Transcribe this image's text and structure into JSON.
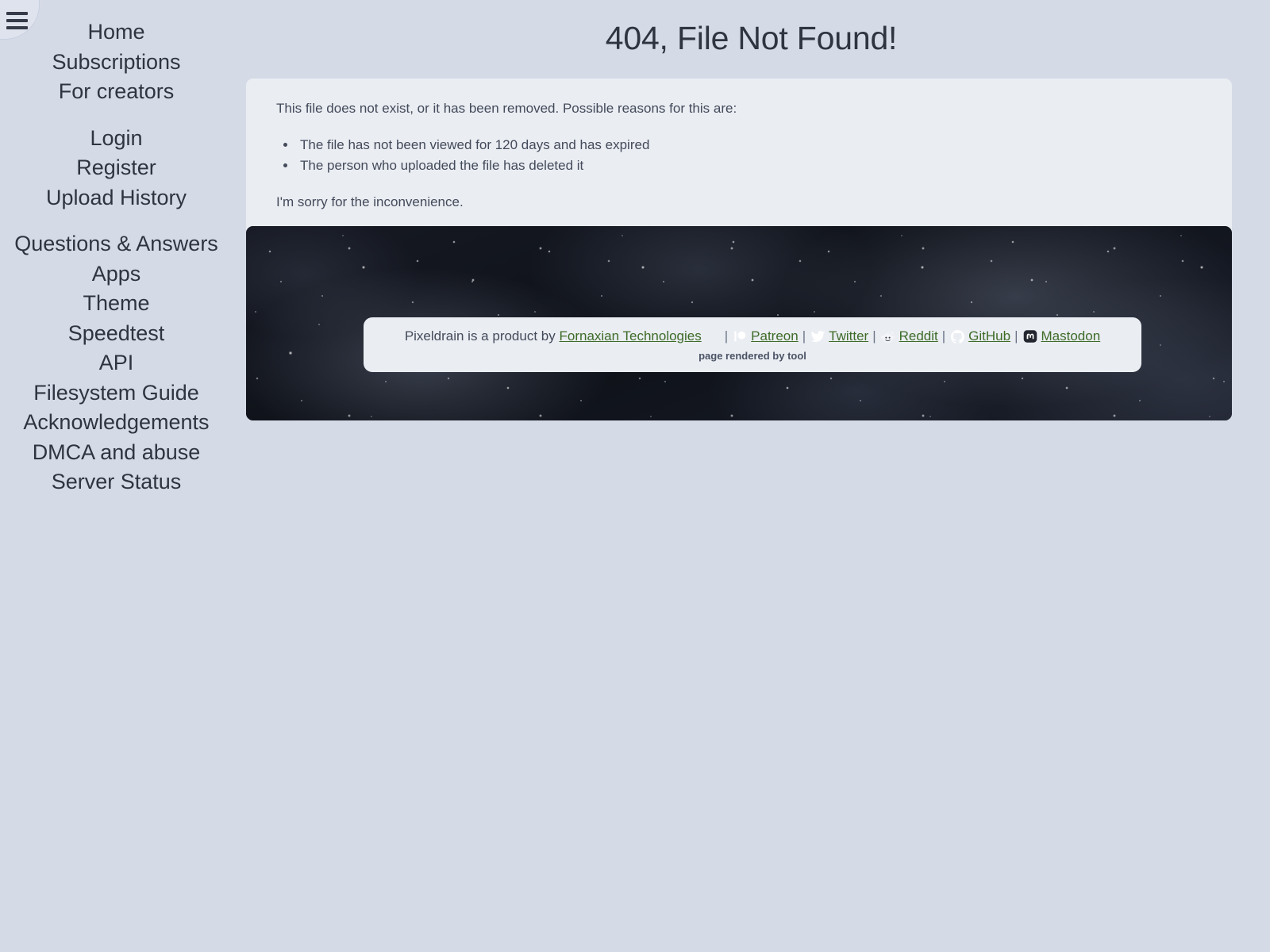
{
  "app": {
    "name": "Pixeldrain",
    "menu_toggle_label": "Toggle navigation menu"
  },
  "sidebar": {
    "groups": [
      {
        "items": [
          {
            "label": "Home",
            "icon": "home-icon"
          },
          {
            "label": "Subscriptions",
            "icon": "subscriptions-icon"
          },
          {
            "label": "For creators",
            "icon": "creators-icon"
          }
        ]
      },
      {
        "items": [
          {
            "label": "Login",
            "icon": "login-icon"
          },
          {
            "label": "Register",
            "icon": "register-icon"
          },
          {
            "label": "Upload History",
            "icon": "history-icon"
          }
        ]
      },
      {
        "items": [
          {
            "label": "Questions & Answers",
            "icon": "qa-icon"
          },
          {
            "label": "Apps",
            "icon": "apps-icon"
          },
          {
            "label": "Theme",
            "icon": "theme-icon"
          },
          {
            "label": "Speedtest",
            "icon": "speedtest-icon"
          },
          {
            "label": "API",
            "icon": "api-icon"
          },
          {
            "label": "Filesystem Guide",
            "icon": "filesystem-icon"
          },
          {
            "label": "Acknowledgements",
            "icon": "acknowledgements-icon"
          },
          {
            "label": "DMCA and abuse",
            "icon": "dmca-icon"
          },
          {
            "label": "Server Status",
            "icon": "status-icon"
          }
        ]
      }
    ]
  },
  "main": {
    "title": "404, File Not Found!",
    "intro": "This file does not exist, or it has been removed. Possible reasons for this are:",
    "reasons": [
      "The file has not been viewed for 120 days and has expired",
      "The person who uploaded the file has deleted it"
    ],
    "apology": "I'm sorry for the inconvenience."
  },
  "footer": {
    "product_text": "Pixeldrain is a product by",
    "company_link": "Fornaxian Technologies",
    "socials": [
      {
        "label": "Patreon",
        "icon": "patreon-icon"
      },
      {
        "label": "Twitter",
        "icon": "twitter-icon"
      },
      {
        "label": "Reddit",
        "icon": "reddit-icon"
      },
      {
        "label": "GitHub",
        "icon": "github-icon"
      },
      {
        "label": "Mastodon",
        "icon": "mastodon-icon"
      }
    ],
    "separator": "|",
    "rendered_by": "page rendered by tool"
  },
  "colors": {
    "page_background": "#d5dae7",
    "card_background": "#eaedf2",
    "text": "#2e3440",
    "link_green": "#3d6b28",
    "banner_dark": "#13161f"
  }
}
